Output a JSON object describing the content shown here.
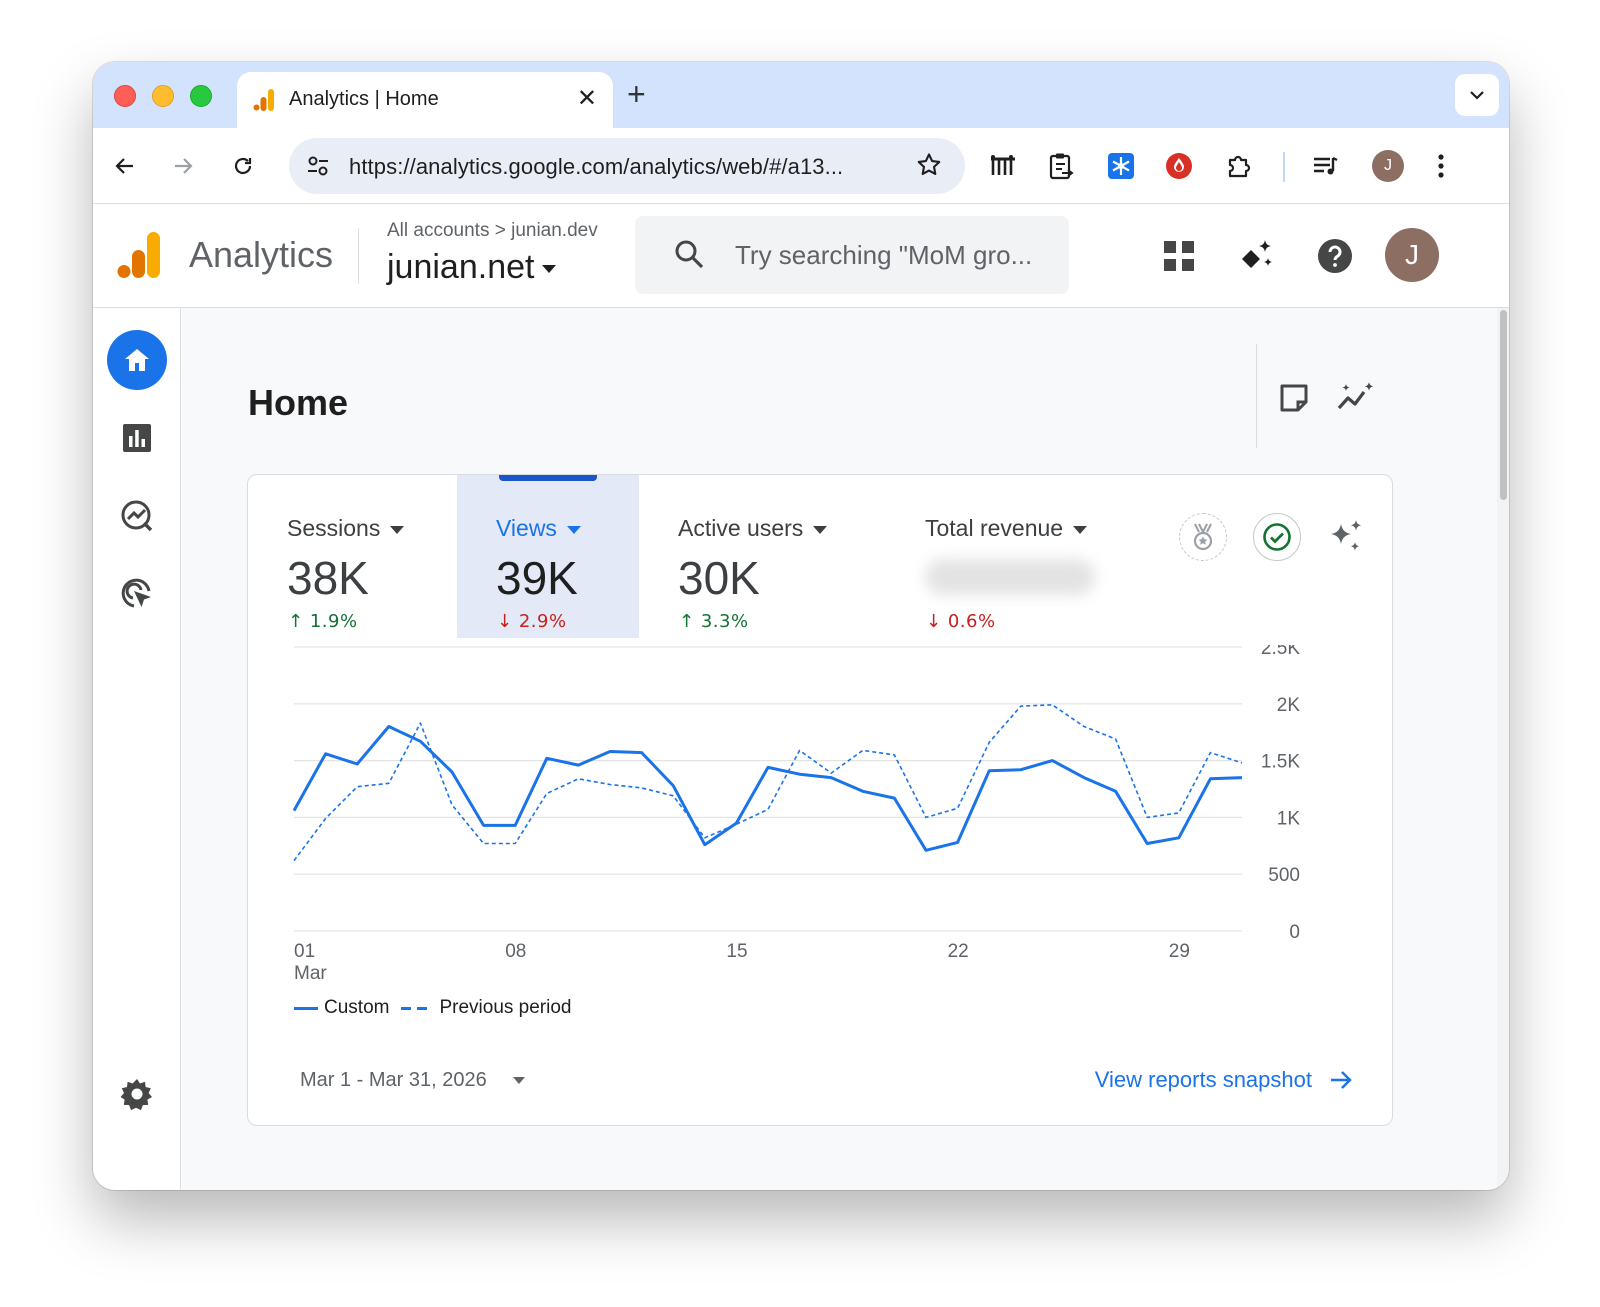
{
  "browser": {
    "tab_title": "Analytics | Home",
    "tab_close": "✕",
    "new_tab": "+",
    "url": "https://analytics.google.com/analytics/web/#/a13...",
    "profile_initial": "J"
  },
  "header": {
    "product": "Analytics",
    "breadcrumb": "All accounts > junian.dev",
    "property": "junian.net",
    "search_placeholder": "Try searching \"MoM gro...",
    "avatar_initial": "J"
  },
  "page": {
    "title": "Home"
  },
  "metrics": [
    {
      "label": "Sessions",
      "value": "38K",
      "change": "1.9%",
      "direction": "up"
    },
    {
      "label": "Views",
      "value": "39K",
      "change": "2.9%",
      "direction": "down",
      "selected": true
    },
    {
      "label": "Active users",
      "value": "30K",
      "change": "3.3%",
      "direction": "up"
    },
    {
      "label": "Total revenue",
      "value": "",
      "change": "0.6%",
      "direction": "down"
    }
  ],
  "chart_data": {
    "type": "line",
    "x": [
      1,
      2,
      3,
      4,
      5,
      6,
      7,
      8,
      9,
      10,
      11,
      12,
      13,
      14,
      15,
      16,
      17,
      18,
      19,
      20,
      21,
      22,
      23,
      24,
      25,
      26,
      27,
      28,
      29,
      30,
      31
    ],
    "x_tick_labels": [
      "01",
      "08",
      "15",
      "22",
      "29"
    ],
    "x_tick_positions": [
      1,
      8,
      15,
      22,
      29
    ],
    "x_sublabel": "Mar",
    "y_tick_labels": [
      "2.5K",
      "2K",
      "1.5K",
      "1K",
      "500",
      "0"
    ],
    "ylim": [
      0,
      2500
    ],
    "series": [
      {
        "name": "Custom",
        "style": "solid",
        "color": "#1a73e8",
        "values": [
          1060,
          1560,
          1470,
          1800,
          1670,
          1400,
          930,
          930,
          1520,
          1460,
          1580,
          1570,
          1280,
          760,
          950,
          1440,
          1380,
          1350,
          1230,
          1170,
          710,
          780,
          1410,
          1420,
          1500,
          1350,
          1230,
          770,
          820,
          1340,
          1350
        ]
      },
      {
        "name": "Previous period",
        "style": "dashed",
        "color": "#1a73e8",
        "values": [
          620,
          990,
          1270,
          1300,
          1830,
          1110,
          770,
          770,
          1210,
          1340,
          1290,
          1260,
          1190,
          820,
          940,
          1070,
          1590,
          1390,
          1590,
          1550,
          1000,
          1080,
          1660,
          1980,
          1990,
          1800,
          1690,
          1000,
          1040,
          1570,
          1480
        ]
      }
    ],
    "grid": true
  },
  "legend": {
    "custom": "Custom",
    "previous": "Previous period"
  },
  "footer": {
    "date_range": "Mar 1 - Mar 31, 2026",
    "snapshot_link": "View reports snapshot"
  },
  "colors": {
    "accent": "#1a73e8",
    "positive": "#137333",
    "negative": "#c5221f"
  }
}
